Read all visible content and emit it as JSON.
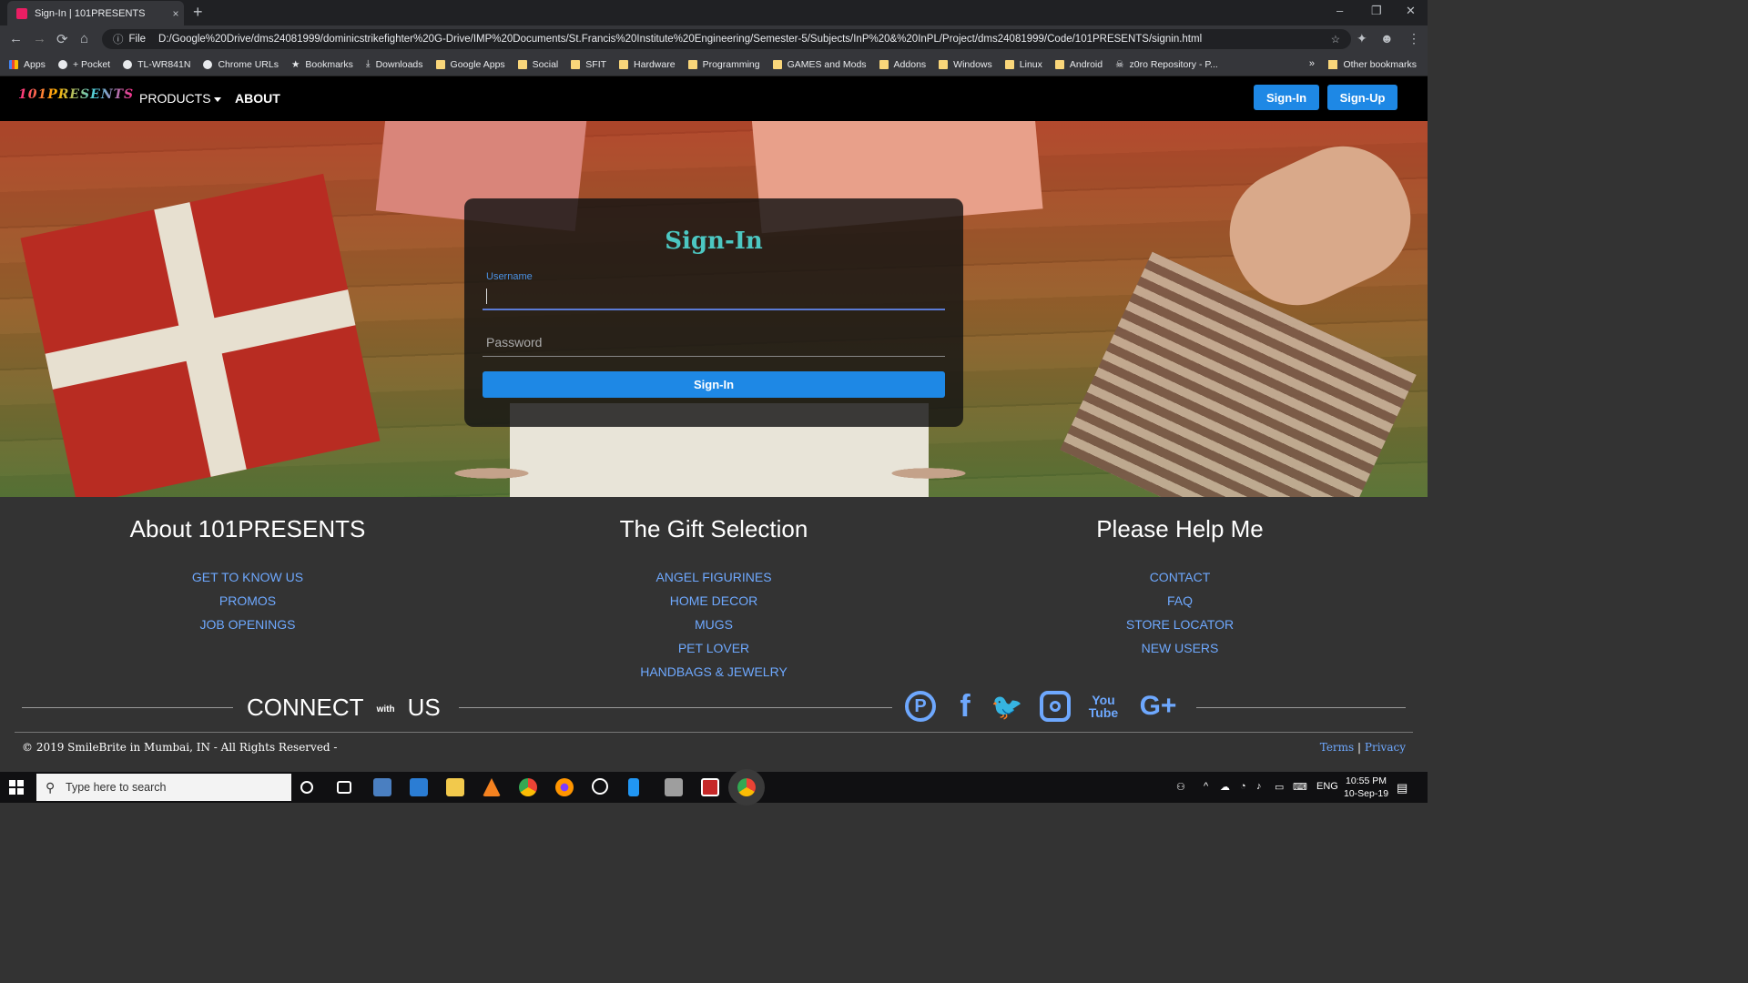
{
  "browser": {
    "tab_title": "Sign-In | 101PRESENTS",
    "tab_close": "×",
    "new_tab": "+",
    "window_controls": [
      "–",
      "❐",
      "✕"
    ],
    "nav_icons": [
      "←",
      "→",
      "⟳",
      "⌂"
    ],
    "info_icon": "ⓘ",
    "scheme": "File",
    "url": "D:/Google%20Drive/dms24081999/dominicstrikefighter%20G-Drive/IMP%20Documents/St.Francis%20Institute%20Engineering/Semester-5/Subjects/InP%20&%20InPL/Project/dms24081999/Code/101PRESENTS/signin.html",
    "star_icon": "☆",
    "bookmarks": [
      "Apps",
      "+ Pocket",
      "TL-WR841N",
      "Chrome URLs",
      "Bookmarks",
      "Downloads",
      "Google Apps",
      "Social",
      "SFIT",
      "Hardware",
      "Programming",
      "GAMES and Mods",
      "Addons",
      "Windows",
      "Linux",
      "Android",
      "z0ro Repository - P..."
    ],
    "bookmarks_more": "»",
    "other_bookmarks": "Other bookmarks"
  },
  "site_nav": {
    "logo": "101PRESENTS",
    "products": "PRODUCTS",
    "about": "ABOUT",
    "signin": "Sign-In",
    "signup": "Sign-Up"
  },
  "signin_form": {
    "title": "Sign-In",
    "username_label": "Username",
    "username_value": "",
    "password_placeholder": "Password",
    "submit": "Sign-In"
  },
  "footer": {
    "columns": [
      {
        "heading": "About 101PRESENTS",
        "links": [
          "GET TO KNOW US",
          "PROMOS",
          "JOB OPENINGS"
        ]
      },
      {
        "heading": "The Gift Selection",
        "links": [
          "ANGEL FIGURINES",
          "HOME DECOR",
          "MUGS",
          "PET LOVER",
          "HANDBAGS & JEWELRY"
        ]
      },
      {
        "heading": "Please Help Me",
        "links": [
          "CONTACT",
          "FAQ",
          "STORE LOCATOR",
          "NEW USERS"
        ]
      }
    ],
    "connect": {
      "word1": "CONNECT",
      "word2": "with",
      "word3": "US"
    },
    "social": {
      "pinterest": "P",
      "facebook": "f",
      "twitter": "🐦",
      "youtube_top": "You",
      "youtube_bottom": "Tube",
      "google_plus": "G+"
    },
    "copyright": "© 2019 SmileBrite in Mumbai, IN - All Rights Reserved -",
    "terms": "Terms",
    "separator": "|",
    "privacy": "Privacy"
  },
  "taskbar": {
    "search_placeholder": "Type here to search",
    "search_icon": "⚲",
    "language": "ENG",
    "time": "10:55 PM",
    "date": "10-Sep-19"
  }
}
